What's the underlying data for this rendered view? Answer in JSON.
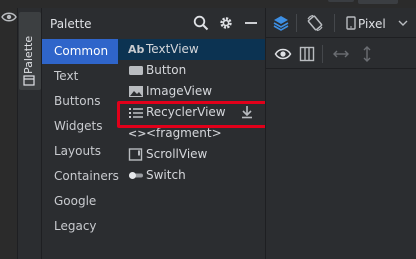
{
  "rail": {
    "tab_label": "Palette"
  },
  "palette": {
    "title": "Palette",
    "header_icons": [
      "search-icon",
      "gear-icon",
      "minimize-icon"
    ],
    "categories": [
      {
        "label": "Common",
        "selected": true
      },
      {
        "label": "Text",
        "selected": false
      },
      {
        "label": "Buttons",
        "selected": false
      },
      {
        "label": "Widgets",
        "selected": false
      },
      {
        "label": "Layouts",
        "selected": false
      },
      {
        "label": "Containers",
        "selected": false
      },
      {
        "label": "Google",
        "selected": false
      },
      {
        "label": "Legacy",
        "selected": false
      }
    ],
    "components": [
      {
        "label": "TextView",
        "icon": "textview-icon",
        "icon_text": "Ab",
        "selected": true
      },
      {
        "label": "Button",
        "icon": "button-icon",
        "selected": false
      },
      {
        "label": "ImageView",
        "icon": "image-icon",
        "selected": false
      },
      {
        "label": "RecyclerView",
        "icon": "list-icon",
        "selected": false,
        "highlighted": true,
        "download": true
      },
      {
        "label": "<fragment>",
        "icon": "code-icon",
        "icon_text": "<>",
        "selected": false
      },
      {
        "label": "ScrollView",
        "icon": "scrollview-icon",
        "selected": false
      },
      {
        "label": "Switch",
        "icon": "switch-icon",
        "selected": false
      }
    ]
  },
  "design": {
    "device_label": "Pixel",
    "toolbar1_icons": [
      "layers-icon",
      "rotate-icon",
      "phone-icon",
      "chevron-down-icon"
    ],
    "toolbar2_icons": [
      "eye-icon",
      "columns-icon",
      "horizontal-resize-icon",
      "vertical-resize-icon"
    ]
  },
  "colors": {
    "selected_category": "#2f65ca",
    "selected_component": "#0c3352",
    "highlight_box": "#e1001a",
    "panel_bg": "#2b2d30"
  }
}
